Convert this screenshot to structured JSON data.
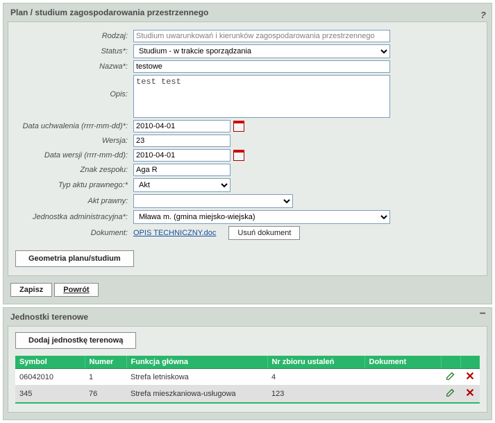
{
  "panel1": {
    "title": "Plan / studium zagospodarowania przestrzennego",
    "help": "?",
    "labels": {
      "rodzaj": "Rodzaj:",
      "status": "Status*:",
      "nazwa": "Nazwa*:",
      "opis": "Opis:",
      "data_uchwalenia": "Data uchwalenia (rrrr-mm-dd)*:",
      "wersja": "Wersja:",
      "data_wersji": "Data wersji (rrrr-mm-dd):",
      "znak_zespolu": "Znak zespołu:",
      "typ_aktu": "Typ aktu prawnego:*",
      "akt_prawny": "Akt prawny:",
      "jednostka_adm": "Jednostka administracyjna*:",
      "dokument": "Dokument:"
    },
    "values": {
      "rodzaj": "Studium uwarunkowań i kierunków zagospodarowania przestrzennego",
      "status": "Studium - w trakcie sporządzania",
      "nazwa": "testowe",
      "opis": "test test",
      "data_uchwalenia": "2010-04-01",
      "wersja": "23",
      "data_wersji": "2010-04-01",
      "znak_zespolu": "Aga R",
      "typ_aktu": "Akt",
      "akt_prawny": "",
      "jednostka_adm": "Mława m. (gmina miejsko-wiejska)",
      "dokument_link": "OPIS TECHNICZNY.doc",
      "delete_doc_btn": "Usuń dokument"
    },
    "buttons": {
      "geometry": "Geometria planu/studium",
      "save": "Zapisz",
      "back": "Powrót"
    }
  },
  "panel2": {
    "title": "Jednostki terenowe",
    "minus": "−",
    "add_btn": "Dodaj jednostkę terenową",
    "headers": {
      "symbol": "Symbol",
      "numer": "Numer",
      "funkcja": "Funkcja główna",
      "nr_zbioru": "Nr zbioru ustaleń",
      "dokument": "Dokument",
      "edit": "",
      "delete": ""
    },
    "rows": [
      {
        "symbol": "06042010",
        "numer": "1",
        "funkcja": "Strefa letniskowa",
        "nr_zbioru": "4",
        "dokument": ""
      },
      {
        "symbol": "345",
        "numer": "76",
        "funkcja": "Strefa mieszkaniowa-usługowa",
        "nr_zbioru": "123",
        "dokument": ""
      }
    ]
  }
}
